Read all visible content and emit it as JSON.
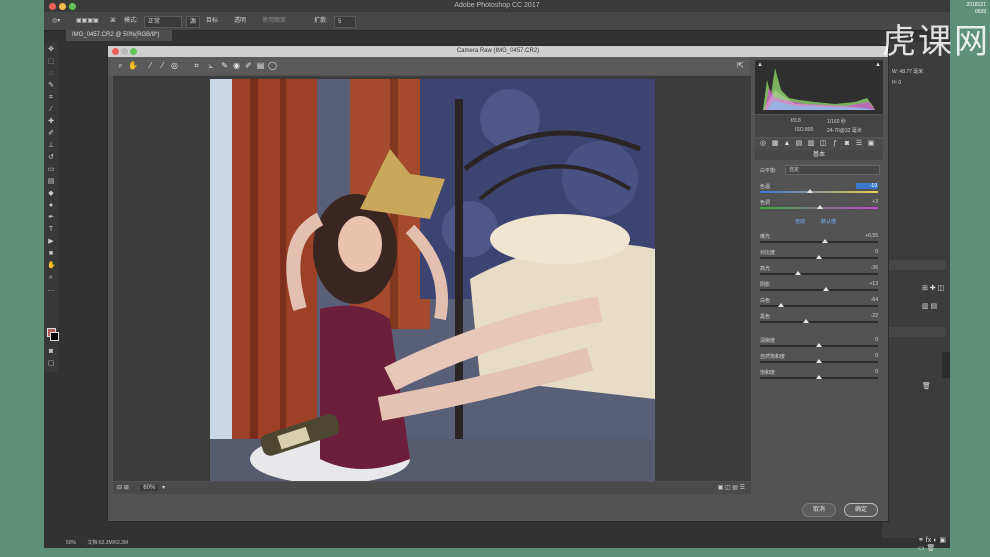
{
  "app": {
    "window_title": "Adobe Photoshop CC 2017",
    "doc_tab": "IMG_0457.CR2 @ 50%(RGB/8*)",
    "status_zoom": "50%",
    "status_doc": "文档:63.3M/63.3M",
    "options": {
      "mode_label": "模式:",
      "mode_value": "正常",
      "item1": "源",
      "item2": "目标",
      "item3": "透明",
      "item4": "使用图案",
      "spread_label": "扩散:",
      "spread_value": "5"
    },
    "colors": {
      "bg": "#5e8f79",
      "ps": "#323232",
      "accent": "#3a78c9"
    }
  },
  "camera_raw": {
    "title": "Camera Raw (IMG_0457.CR2)",
    "zoom": "60%",
    "cam_info": {
      "f": "f/3.8",
      "shutter": "1/160 秒",
      "iso": "ISO 800",
      "lens": "24-70@32 毫米"
    },
    "panel_title": "基本",
    "wb_label": "白平衡:",
    "wb_value": "自定",
    "auto_label": "自动",
    "default_label": "默认值",
    "sliders": [
      {
        "label": "色温",
        "value": "-19",
        "pos": 0.42,
        "selected": true
      },
      {
        "label": "色调",
        "value": "+3",
        "pos": 0.51,
        "selected": false
      },
      {
        "label": "曝光",
        "value": "+0.55",
        "pos": 0.55
      },
      {
        "label": "对比度",
        "value": "0",
        "pos": 0.5
      },
      {
        "label": "高光",
        "value": "-36",
        "pos": 0.32
      },
      {
        "label": "阴影",
        "value": "+13",
        "pos": 0.56
      },
      {
        "label": "白色",
        "value": "-64",
        "pos": 0.18
      },
      {
        "label": "黑色",
        "value": "-22",
        "pos": 0.39
      },
      {
        "label": "清晰度",
        "value": "0",
        "pos": 0.5
      },
      {
        "label": "自然饱和度",
        "value": "0",
        "pos": 0.5
      },
      {
        "label": "饱和度",
        "value": "0",
        "pos": 0.5
      }
    ],
    "cancel_label": "取消",
    "ok_label": "确定"
  },
  "right_info": {
    "w": "W: 48.77 毫米",
    "h": "H: 0"
  },
  "watermark": {
    "text": "虎课网",
    "date": "2018121",
    "id": "0039"
  }
}
